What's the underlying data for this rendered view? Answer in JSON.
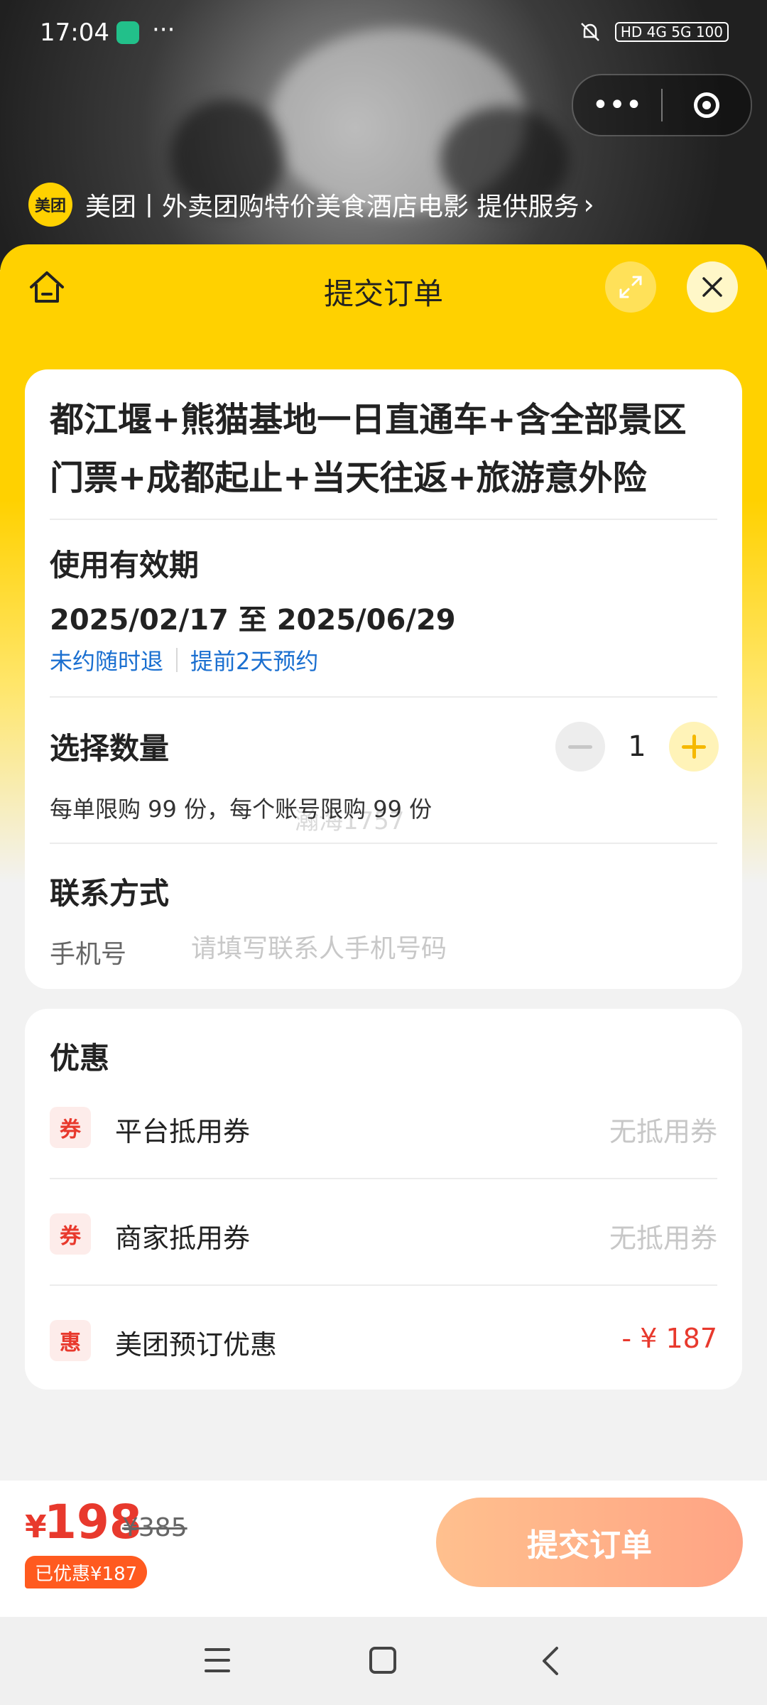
{
  "status_bar": {
    "time": "17:04",
    "dots": "···",
    "right_icons": "HD 4G 5G 100"
  },
  "capsule": {
    "more": "•••"
  },
  "provider": {
    "logo": "美团",
    "text": "美团丨外卖团购特价美食酒店电影 提供服务",
    "chevron": "›"
  },
  "header": {
    "title": "提交订单"
  },
  "product": {
    "title": "都江堰+熊猫基地一日直通车+含全部景区门票+成都起止+当天往返+旅游意外险"
  },
  "validity": {
    "title": "使用有效期",
    "dates": "2025/02/17 至 2025/06/29",
    "tags": [
      "未约随时退",
      "提前2天预约"
    ]
  },
  "quantity": {
    "title": "选择数量",
    "value": "1",
    "limit": "每单限购 99 份，每个账号限购 99 份",
    "watermark": "瀚海1757"
  },
  "contact": {
    "title": "联系方式",
    "phone_label": "手机号",
    "phone_placeholder": "请填写联系人手机号码",
    "phone_value": ""
  },
  "discounts": {
    "title": "优惠",
    "items": [
      {
        "badge": "券",
        "label": "平台抵用券",
        "value": "无抵用券"
      },
      {
        "badge": "券",
        "label": "商家抵用券",
        "value": "无抵用券"
      },
      {
        "badge": "惠",
        "label": "美团预订优惠",
        "value": "- ¥ 187"
      }
    ]
  },
  "footer": {
    "currency": "¥",
    "price": "198",
    "original_price": "¥385",
    "saved": "已优惠¥187",
    "submit_label": "提交订单"
  },
  "colors": {
    "brand_yellow": "#ffd100",
    "price_red": "#e8392d",
    "link_blue": "#1a6fd0"
  }
}
